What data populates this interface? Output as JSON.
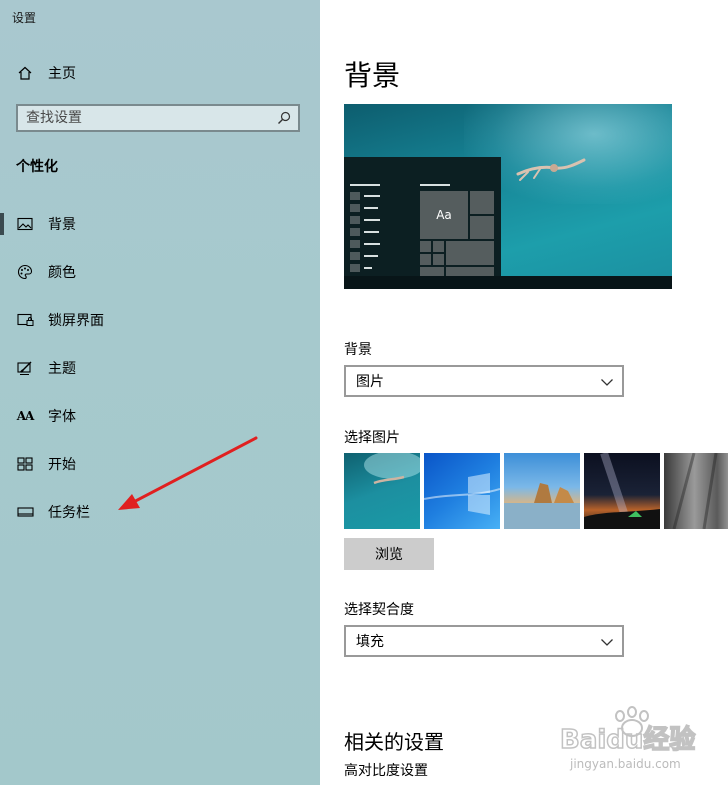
{
  "window": {
    "title": "设置"
  },
  "sidebar": {
    "home_label": "主页",
    "search_placeholder": "查找设置",
    "section_title": "个性化",
    "items": [
      {
        "label": "背景",
        "icon": "picture-icon",
        "active": true
      },
      {
        "label": "颜色",
        "icon": "palette-icon",
        "active": false
      },
      {
        "label": "锁屏界面",
        "icon": "lock-screen-icon",
        "active": false
      },
      {
        "label": "主题",
        "icon": "theme-brush-icon",
        "active": false
      },
      {
        "label": "字体",
        "icon": "font-icon",
        "active": false
      },
      {
        "label": "开始",
        "icon": "start-grid-icon",
        "active": false
      },
      {
        "label": "任务栏",
        "icon": "taskbar-icon",
        "active": false
      }
    ],
    "font_icon_glyph": "AA"
  },
  "main": {
    "title": "背景",
    "preview": {
      "tile_label": "Aa"
    },
    "background_label": "背景",
    "background_value": "图片",
    "choose_picture_label": "选择图片",
    "browse_label": "浏览",
    "fit_label": "选择契合度",
    "fit_value": "填充",
    "related_title": "相关的设置",
    "related_link": "高对比度设置"
  },
  "watermark": {
    "brand": "Baidu经验",
    "url": "jingyan.baidu.com"
  },
  "colors": {
    "sidebar_bg": "#a6c9cd",
    "annotation_arrow": "#e02020",
    "button_gray": "#cccccc"
  }
}
